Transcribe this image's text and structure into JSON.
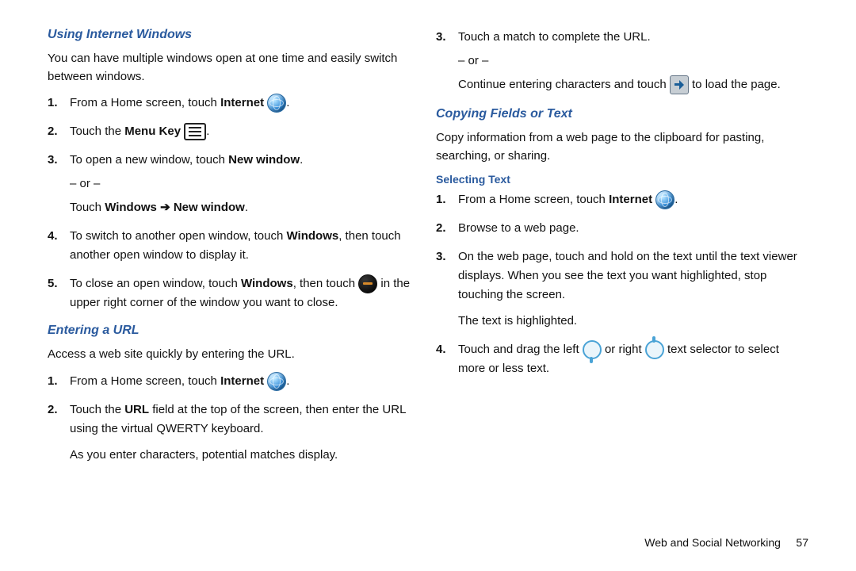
{
  "left": {
    "section1": {
      "heading": "Using Internet Windows",
      "intro": "You can have multiple windows open at one time and easily switch between windows.",
      "steps": {
        "s1_pre": "From a Home screen, touch ",
        "s1_bold": "Internet",
        "s1_post": ".",
        "s2_pre": "Touch the ",
        "s2_bold": "Menu Key",
        "s2_post": ".",
        "s3_pre": "To open a new window, touch ",
        "s3_bold": "New window",
        "s3_post": ".",
        "s3_or": "– or –",
        "s3b_pre": "Touch ",
        "s3b_bold1": "Windows",
        "s3b_arrow": " ➔ ",
        "s3b_bold2": "New window",
        "s3b_post": ".",
        "s4_pre": "To switch to another open window, touch ",
        "s4_bold": "Windows",
        "s4_post": ", then touch another open window to display it.",
        "s5_pre": "To close an open window, touch ",
        "s5_bold": "Windows",
        "s5_mid": ", then touch ",
        "s5_post": " in the upper right corner of the window you want to close."
      }
    },
    "section2": {
      "heading": "Entering a URL",
      "intro": "Access a web site quickly by entering the URL.",
      "steps": {
        "s1_pre": "From a Home screen, touch ",
        "s1_bold": "Internet",
        "s1_post": ".",
        "s2_pre": "Touch the ",
        "s2_bold": "URL",
        "s2_post": " field at the top of the screen, then enter the URL using the virtual QWERTY keyboard.",
        "s2_extra": "As you enter characters, potential matches display."
      }
    }
  },
  "right": {
    "continued": {
      "s3": "Touch a match to complete the URL.",
      "s3_or": "– or –",
      "s3b_pre": "Continue entering characters and touch ",
      "s3b_post": " to load the page."
    },
    "section1": {
      "heading": "Copying Fields or Text",
      "intro": "Copy information from a web page to the clipboard for pasting, searching, or sharing."
    },
    "subsection": {
      "heading": "Selecting Text",
      "steps": {
        "s1_pre": "From a Home screen, touch ",
        "s1_bold": "Internet",
        "s1_post": ".",
        "s2": "Browse to a web page.",
        "s3": "On the web page, touch and hold on the text until the text viewer displays. When you see the text you want highlighted, stop touching the screen.",
        "s3_extra": "The text is highlighted.",
        "s4_pre": "Touch and drag the left ",
        "s4_mid": " or right ",
        "s4_post": " text selector to select more or less text."
      }
    }
  },
  "footer": {
    "chapter": "Web and Social Networking",
    "page": "57"
  },
  "nums": {
    "n1": "1.",
    "n2": "2.",
    "n3": "3.",
    "n4": "4.",
    "n5": "5."
  }
}
